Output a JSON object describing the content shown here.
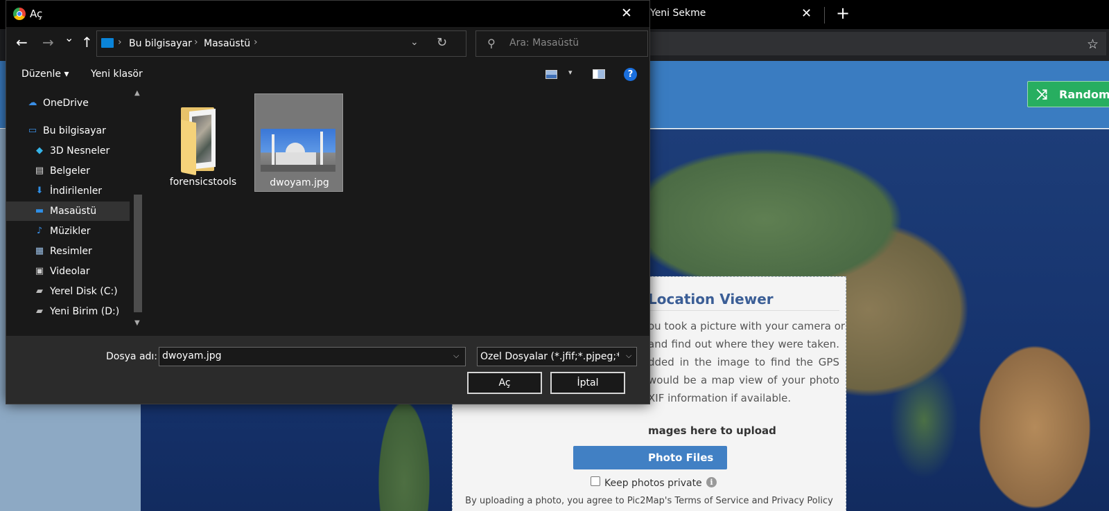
{
  "browser": {
    "tab_title": "Yeni Sekme",
    "tab_close": "✕",
    "new_tab": "+",
    "star": "☆"
  },
  "page": {
    "random_button": "Random L",
    "upload": {
      "title": "Location Viewer",
      "lines": [
        "ou took a picture with your camera or",
        "and find out where they were taken.",
        "dded in the image to find the GPS",
        "would be a map view of your photo",
        "XIF information if available."
      ],
      "drag_text": "mages here to upload",
      "photo_files_button": "Photo Files",
      "private_label": "Keep photos private",
      "info": "i",
      "terms": "By uploading a photo, you agree to Pic2Map's Terms of Service and Privacy Policy"
    }
  },
  "dialog": {
    "title": "Aç",
    "close": "✕",
    "nav": {
      "back": "←",
      "forward": "→",
      "recent": "⌄",
      "up": "↑",
      "breadcrumbs": [
        "Bu bilgisayar",
        "Masaüstü"
      ],
      "separator": "›",
      "dropdown": "⌄",
      "refresh": "↻"
    },
    "search": {
      "placeholder": "Ara: Masaüstü",
      "icon": "⚲"
    },
    "commands": {
      "organize": "Düzenle ▾",
      "new_folder": "Yeni klasör",
      "view_caret": "▾",
      "help": "?"
    },
    "sidebar": {
      "items": [
        {
          "label": "OneDrive",
          "icon": "cloud-icon",
          "color": "#3a8ee6",
          "selected": false
        },
        {
          "label": "Bu bilgisayar",
          "icon": "computer-icon",
          "color": "#3a8ee6",
          "selected": false
        },
        {
          "label": "3D Nesneler",
          "icon": "cube-icon",
          "color": "#36b4e8",
          "selected": false
        },
        {
          "label": "Belgeler",
          "icon": "document-icon",
          "color": "#dddddd",
          "selected": false
        },
        {
          "label": "İndirilenler",
          "icon": "download-icon",
          "color": "#2f8fe6",
          "selected": false
        },
        {
          "label": "Masaüstü",
          "icon": "desktop-icon",
          "color": "#2f8fe6",
          "selected": true
        },
        {
          "label": "Müzikler",
          "icon": "music-icon",
          "color": "#3a8ee6",
          "selected": false
        },
        {
          "label": "Resimler",
          "icon": "pictures-icon",
          "color": "#9bbfe6",
          "selected": false
        },
        {
          "label": "Videolar",
          "icon": "video-icon",
          "color": "#cccccc",
          "selected": false
        },
        {
          "label": "Yerel Disk (C:)",
          "icon": "drive-icon",
          "color": "#bbbbbb",
          "selected": false
        },
        {
          "label": "Yeni Birim (D:)",
          "icon": "drive-icon",
          "color": "#bbbbbb",
          "selected": false
        }
      ]
    },
    "files": [
      {
        "name": "forensicstools",
        "type": "folder",
        "selected": false
      },
      {
        "name": "dwoyam.jpg",
        "type": "image",
        "selected": true
      }
    ],
    "filename_label": "Dosya adı:",
    "filename_value": "dwoyam.jpg",
    "filetype": "Özel Dosyalar (*.jfif;*.pjpeg;*.jpeg;*.pjp;*.jpg)",
    "open_button": "Aç",
    "cancel_button": "İptal"
  }
}
